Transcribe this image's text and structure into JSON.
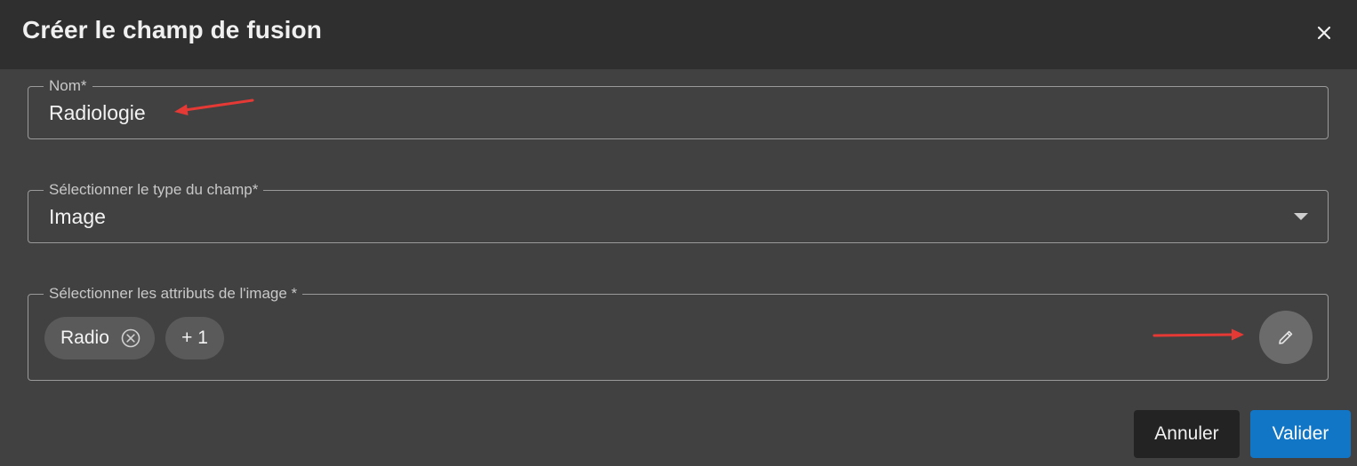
{
  "dialog": {
    "title": "Créer le champ de fusion",
    "close_icon": "close-icon"
  },
  "fields": {
    "name": {
      "label": "Nom*",
      "value": "Radiologie"
    },
    "type": {
      "label": "Sélectionner le type du champ*",
      "value": "Image",
      "icon": "dropdown-arrow-icon"
    },
    "attributes": {
      "label": "Sélectionner les attributs de l'image *",
      "chips": [
        {
          "label": "Radio",
          "icon": "remove-circle-icon"
        }
      ],
      "more_label": "+ 1",
      "edit_icon": "pencil-icon"
    }
  },
  "actions": {
    "cancel_label": "Annuler",
    "submit_label": "Valider"
  },
  "colors": {
    "background": "#414141",
    "header": "#2f2f2f",
    "primary": "#1276c6",
    "annotation_arrow": "#e53935"
  }
}
